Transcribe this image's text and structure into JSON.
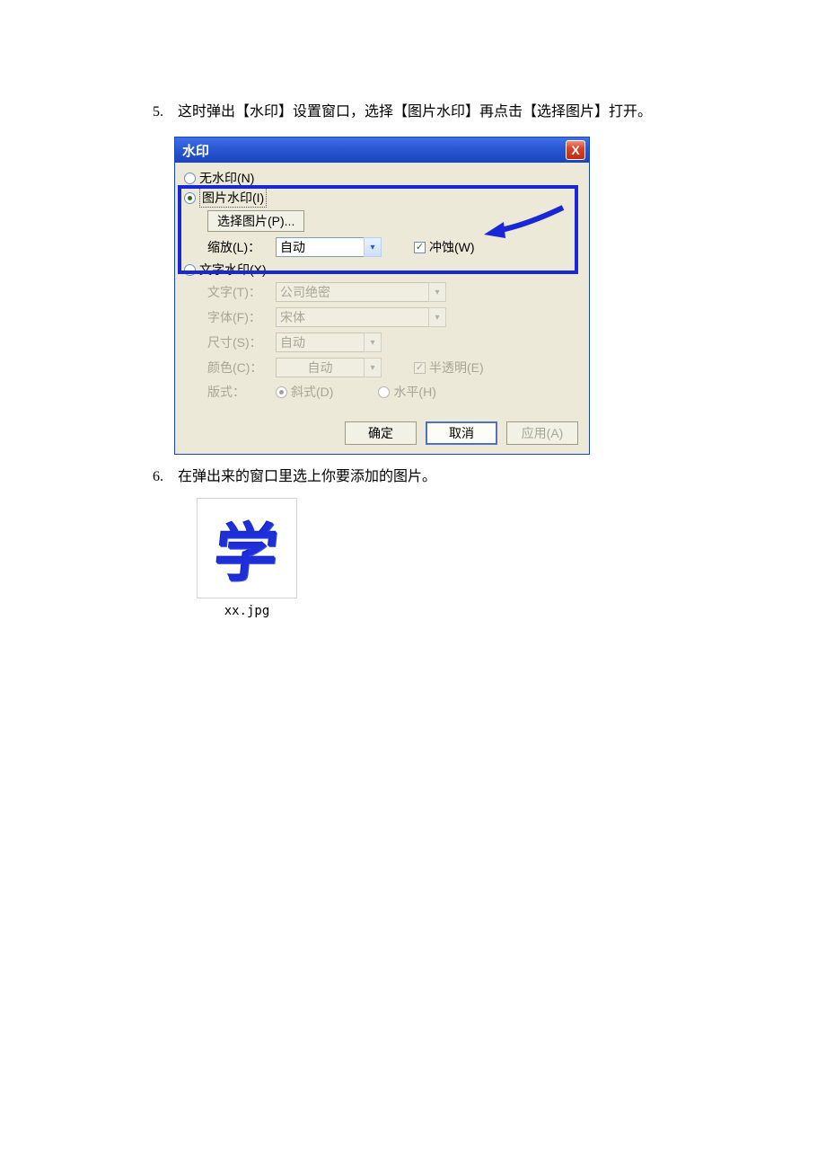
{
  "step5": {
    "num": "5.",
    "text": "这时弹出【水印】设置窗口，选择【图片水印】再点击【选择图片】打开。"
  },
  "step6": {
    "num": "6.",
    "text": "在弹出来的窗口里选上你要添加的图片。"
  },
  "dialog": {
    "title": "水印",
    "close": "X",
    "no_watermark": "无水印(N)",
    "pic_watermark": "图片水印(I)",
    "select_pic_btn": "选择图片(P)...",
    "scale_label": "缩放(L)：",
    "scale_value": "自动",
    "washout_label": "冲蚀(W)",
    "text_watermark": "文字水印(X)",
    "text_label": "文字(T)：",
    "text_value": "公司绝密",
    "font_label": "字体(F)：",
    "font_value": "宋体",
    "size_label": "尺寸(S)：",
    "size_value": "自动",
    "color_label": "颜色(C)：",
    "color_value": "自动",
    "semi_label": "半透明(E)",
    "layout_label": "版式：",
    "layout_diag": "斜式(D)",
    "layout_horiz": "水平(H)",
    "ok": "确定",
    "cancel": "取消",
    "apply": "应用(A)"
  },
  "file": {
    "glyph": "学",
    "name": "xx.jpg"
  }
}
